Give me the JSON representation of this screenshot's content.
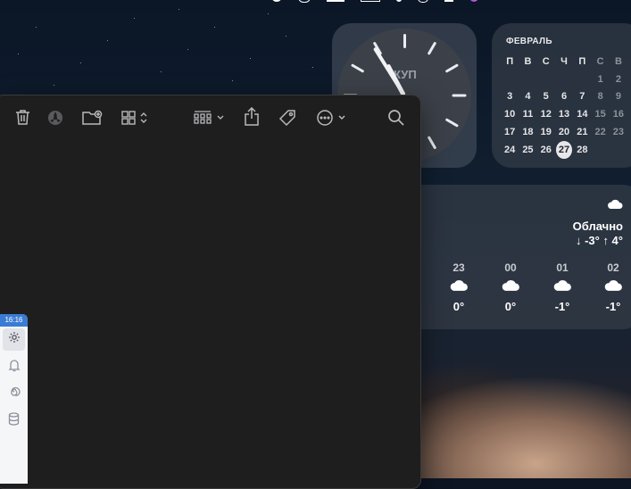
{
  "calendar": {
    "month": "ФЕВРАЛЬ",
    "weekdays": [
      "П",
      "В",
      "С",
      "Ч",
      "П",
      "С",
      "В"
    ],
    "weeks": [
      [
        "",
        "",
        "",
        "",
        "",
        "1",
        "2"
      ],
      [
        "3",
        "4",
        "5",
        "6",
        "7",
        "8",
        "9"
      ],
      [
        "10",
        "11",
        "12",
        "13",
        "14",
        "15",
        "16"
      ],
      [
        "17",
        "18",
        "19",
        "20",
        "21",
        "22",
        "23"
      ],
      [
        "24",
        "25",
        "26",
        "27",
        "28",
        "",
        ""
      ]
    ],
    "today": "27"
  },
  "clock": {
    "city": "КУП"
  },
  "weather": {
    "condition": "Облачно",
    "range": "↓ -3° ↑ 4°",
    "hours": [
      {
        "hour": "23",
        "temp": "0°"
      },
      {
        "hour": "00",
        "temp": "0°"
      },
      {
        "hour": "01",
        "temp": "-1°"
      },
      {
        "hour": "02",
        "temp": "-1°"
      }
    ]
  },
  "side_panel": {
    "time": "16:16"
  },
  "colors": {
    "today_bg": "#e8e8ea",
    "side_time_bg": "#3a7bd5",
    "window_bg": "#1e1e1e"
  },
  "icons": {
    "toolbar": [
      "trash-icon",
      "burn-icon",
      "new-folder-icon",
      "grid-view-icon",
      "group-by-icon",
      "share-icon",
      "tag-icon",
      "more-icon",
      "search-icon"
    ],
    "side": [
      "gear-icon",
      "bell-icon",
      "spiral-icon",
      "database-icon"
    ]
  }
}
